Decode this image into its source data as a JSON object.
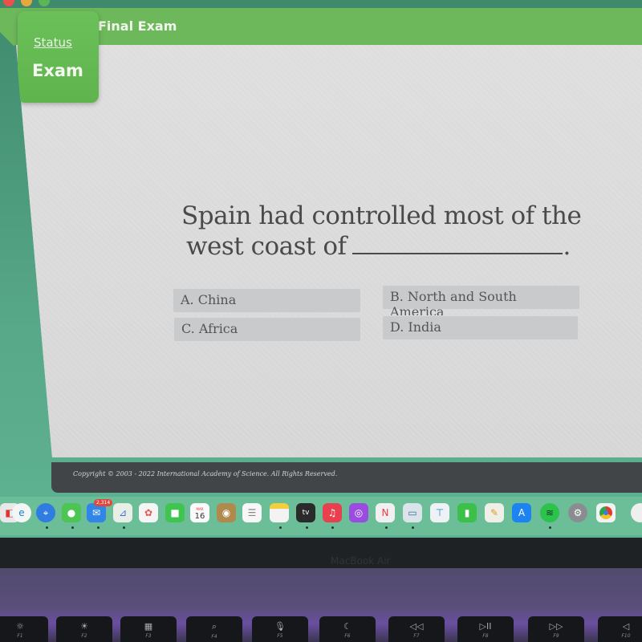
{
  "window": {
    "title": "Final Exam",
    "traffic_lights": [
      "close",
      "minimize",
      "maximize"
    ]
  },
  "status_panel": {
    "link_label": "Status",
    "section_label": "Exam"
  },
  "question": {
    "line1": "Spain had controlled most of the",
    "line2": "west coast of",
    "end_punctuation": "."
  },
  "choices": [
    {
      "letter": "A.",
      "text": "China",
      "label": "A. China"
    },
    {
      "letter": "B.",
      "text": "North and South America",
      "label": "B. North and South America"
    },
    {
      "letter": "C.",
      "text": "Africa",
      "label": "C. Africa"
    },
    {
      "letter": "D.",
      "text": "India",
      "label": "D. India"
    }
  ],
  "footer": {
    "copyright": "Copyright © 2003 - 2022 International Academy of Science.  All Rights Reserved."
  },
  "dock": {
    "mail_badge": "2,314",
    "calendar_month": "MAR",
    "calendar_day": "16",
    "tv_label": "tv",
    "apps": [
      "finder",
      "edge",
      "safari",
      "messages",
      "mail",
      "maps",
      "photos",
      "facetime",
      "calendar",
      "contacts",
      "reminders",
      "notes",
      "apple-tv",
      "music",
      "podcasts",
      "news",
      "preview",
      "keynote",
      "numbers",
      "pages",
      "app-store",
      "spotify",
      "system-preferences",
      "chrome"
    ]
  },
  "hardware": {
    "brand": "MacBook Air",
    "keys": [
      {
        "glyph": "☼",
        "label": "F1"
      },
      {
        "glyph": "☀",
        "label": "F2"
      },
      {
        "glyph": "▦",
        "label": "F3"
      },
      {
        "glyph": "⌕",
        "label": "F4"
      },
      {
        "glyph": "🎙",
        "label": "F5"
      },
      {
        "glyph": "☾",
        "label": "F6"
      },
      {
        "glyph": "◁◁",
        "label": "F7"
      },
      {
        "glyph": "▷II",
        "label": "F8"
      },
      {
        "glyph": "▷▷",
        "label": "F9"
      },
      {
        "glyph": "◁",
        "label": "F10"
      }
    ]
  },
  "colors": {
    "header_green": "#6db85a",
    "badge_green": "#5fb44d",
    "content_bg": "#dcdcdc",
    "choice_bg": "#c8cacc",
    "footer_bg": "#424548",
    "wallpaper": "#58a88a"
  }
}
